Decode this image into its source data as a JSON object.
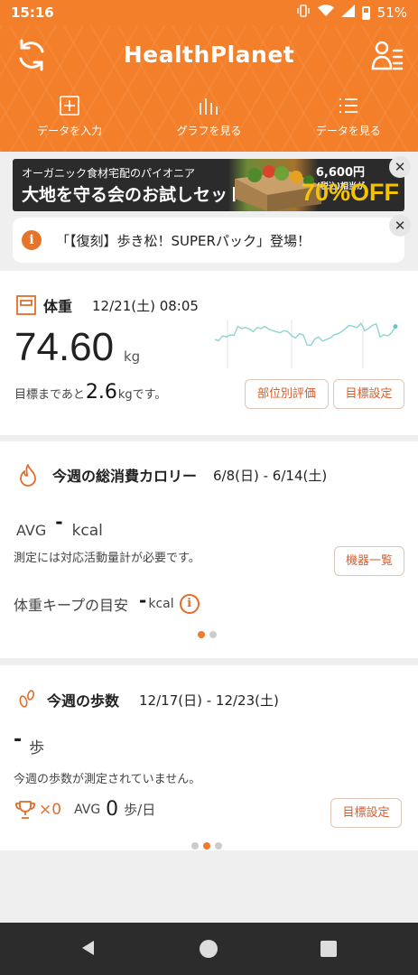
{
  "status_bar": {
    "time": "15:16",
    "battery": "51%"
  },
  "header": {
    "title": "HealthPlanet",
    "nav": [
      {
        "label": "データを入力",
        "icon": "plus-square-icon"
      },
      {
        "label": "グラフを見る",
        "icon": "bar-chart-icon"
      },
      {
        "label": "データを見る",
        "icon": "list-icon"
      }
    ]
  },
  "ad": {
    "line1": "オーガニック食材宅配のパイオニア",
    "line2": "大地を守る会のお試しセット",
    "price": "6,600円",
    "price_note": "(税込)相当が",
    "discount": "70%OFF"
  },
  "notice": {
    "text": "「【復刻】歩き松！SUPERパック」登場！"
  },
  "weight": {
    "title": "体重",
    "datetime": "12/21(土) 08:05",
    "value": "74.60",
    "unit": "kg",
    "goal_prefix": "目標まであと",
    "goal_value": "2.6",
    "goal_suffix": "kgです。",
    "btn_body": "部位別評価",
    "btn_goal": "目標設定",
    "sparkline": [
      0.45,
      0.47,
      0.38,
      0.4,
      0.36,
      0.37,
      0.2,
      0.24,
      0.22,
      0.25,
      0.3,
      0.22,
      0.24,
      0.2,
      0.25,
      0.28,
      0.3,
      0.32,
      0.28,
      0.3,
      0.38,
      0.42,
      0.34,
      0.36,
      0.55,
      0.56,
      0.44,
      0.4,
      0.48,
      0.45,
      0.42,
      0.36,
      0.34,
      0.3,
      0.24,
      0.18,
      0.2,
      0.22,
      0.14,
      0.28,
      0.24,
      0.18,
      0.15,
      0.4,
      0.36,
      0.38,
      0.32,
      0.2
    ]
  },
  "calorie": {
    "title": "今週の総消費カロリー",
    "range": "6/8(日) - 6/14(土)",
    "avg_label": "AVG",
    "avg_value": "-",
    "avg_unit": "kcal",
    "note": "測定には対応活動量計が必要です。",
    "btn_devices": "機器一覧",
    "keep_label": "体重キープの目安",
    "keep_value": "-",
    "keep_unit": "kcal"
  },
  "steps": {
    "title": "今週の歩数",
    "range": "12/17(日) - 12/23(土)",
    "value": "-",
    "unit": "歩",
    "note": "今週の歩数が測定されていません。",
    "trophy_count": "×0",
    "avg_label": "AVG",
    "avg_value": "0",
    "avg_unit": "歩/日",
    "btn_goal": "目標設定"
  }
}
